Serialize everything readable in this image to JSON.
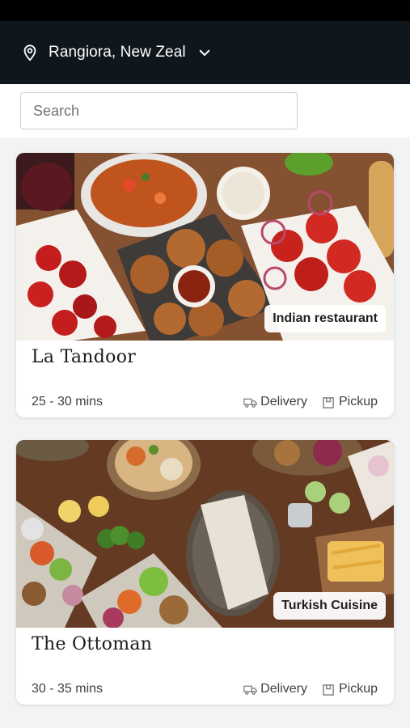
{
  "header": {
    "location": "Rangiora, New Zeal"
  },
  "search": {
    "placeholder": "Search"
  },
  "restaurants": [
    {
      "name": "La Tandoor",
      "cuisine": "Indian restaurant",
      "time": "25 - 30 mins",
      "delivery": "Delivery",
      "pickup": "Pickup"
    },
    {
      "name": "The Ottoman",
      "cuisine": "Turkish Cuisine",
      "time": "30 - 35 mins",
      "delivery": "Delivery",
      "pickup": "Pickup"
    }
  ],
  "icons": {
    "location": "map-pin-icon",
    "dropdown": "chevron-down-icon",
    "delivery": "truck-icon",
    "pickup": "bag-icon"
  }
}
